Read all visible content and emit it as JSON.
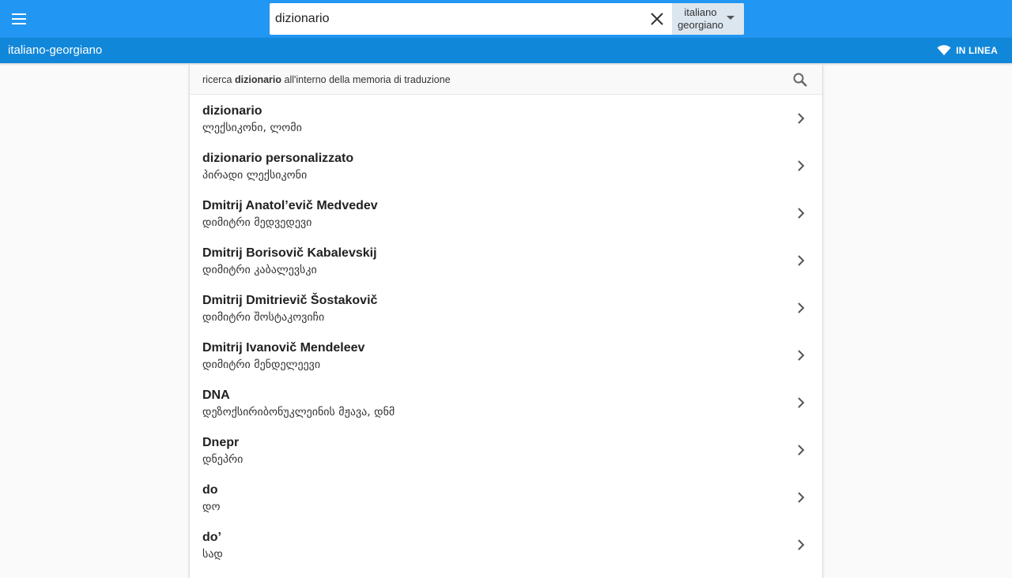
{
  "header": {
    "menu_icon": "menu-icon",
    "search": {
      "value": "dizionario",
      "clear_icon": "close-icon"
    },
    "language_select": {
      "line1": "italiano",
      "line2": "georgiano",
      "icon": "caret-down-icon"
    }
  },
  "subbar": {
    "title": "italiano-georgiano",
    "status": {
      "icon": "wifi-icon",
      "label": "IN LINEA"
    }
  },
  "translation_memory": {
    "prefix": "ricerca",
    "term": "dizionario",
    "suffix": "all'interno della memoria di traduzione",
    "icon": "search-icon"
  },
  "results": [
    {
      "term": "dizionario",
      "translation": "ლექსიკონი, ლომი"
    },
    {
      "term": "dizionario personalizzato",
      "translation": "პირადი ლექსიკონი"
    },
    {
      "term": "Dmitrij Anatol’evič Medvedev",
      "translation": "დიმიტრი მედვედევი"
    },
    {
      "term": "Dmitrij Borisovič Kabalevskij",
      "translation": "დიმიტრი კაბალევსკი"
    },
    {
      "term": "Dmitrij Dmitrievič Šostakovič",
      "translation": "დიმიტრი შოსტაკოვიჩი"
    },
    {
      "term": "Dmitrij Ivanovič Mendeleev",
      "translation": "დიმიტრი მენდელეევი"
    },
    {
      "term": "DNA",
      "translation": "დეზოქსირიბონუკლეინის მჟავა, დნმ"
    },
    {
      "term": "Dnepr",
      "translation": "დნეპრი"
    },
    {
      "term": "do",
      "translation": "დო"
    },
    {
      "term": "do’",
      "translation": "სად"
    }
  ],
  "colors": {
    "topbar": "#2196f3",
    "subbar": "#1187d9",
    "lang_select": "#dbe6ef"
  }
}
